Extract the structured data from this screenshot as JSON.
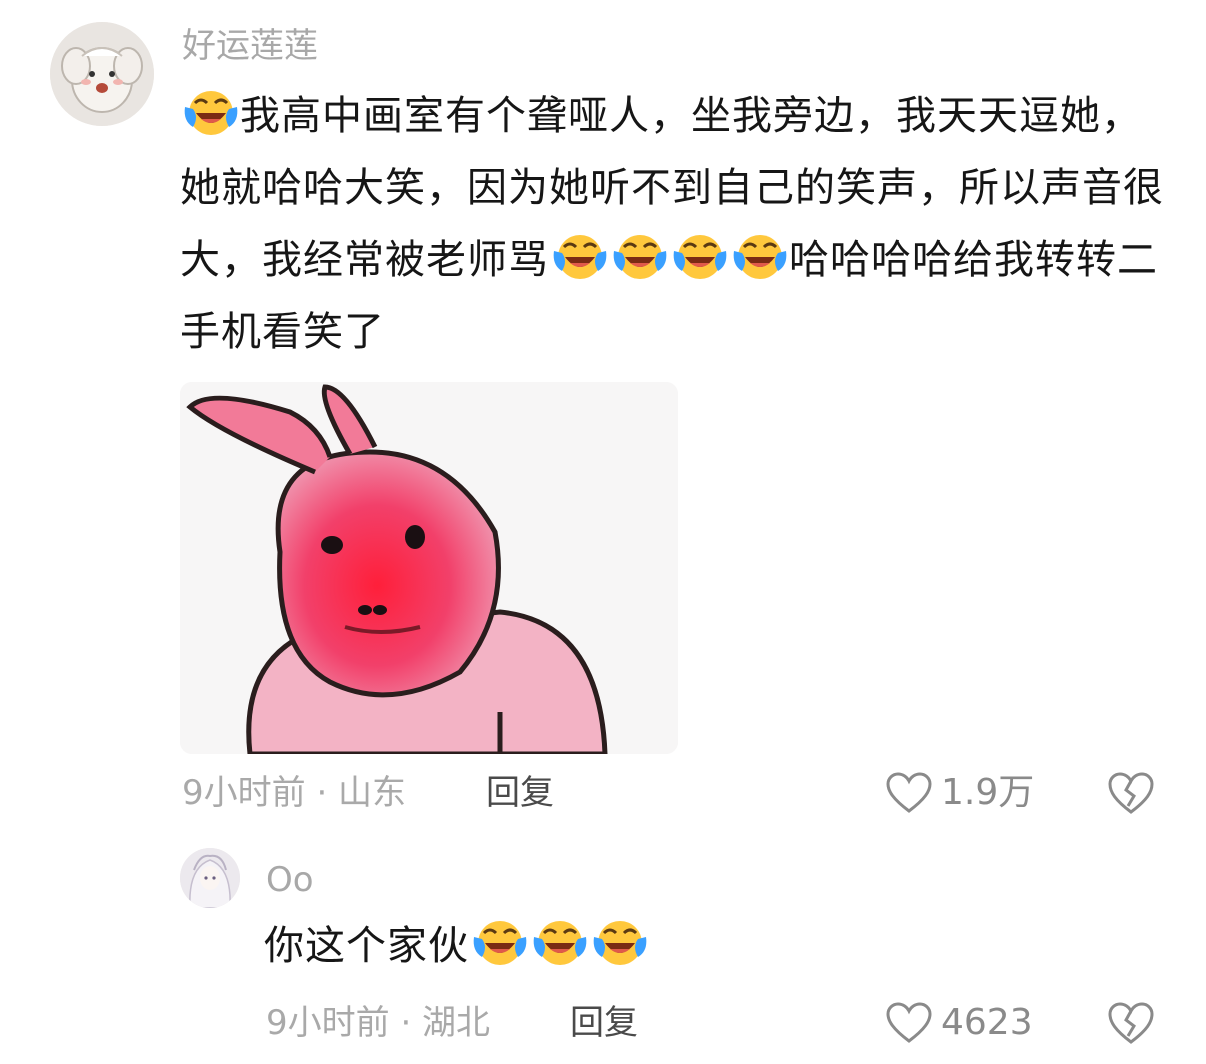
{
  "comments": [
    {
      "username": "好运莲莲",
      "text_segments": [
        "我高中画室有个聋哑人，坐我旁边，我天天逗她，她就哈哈大笑，因为她听不到自己的笑声，所以声音很大，我经常被老师骂",
        "哈哈哈哈给我转转二手机看笑了"
      ],
      "leading_emoji": "laughing-crying-emoji",
      "middle_emoji_count": 4,
      "time_location": "9小时前 · 山东",
      "reply_label": "回复",
      "like_count": "1.9万"
    },
    {
      "username": "Oo",
      "text": "你这个家伙",
      "trailing_emoji_count": 3,
      "time_location": "9小时前 · 湖北",
      "reply_label": "回复",
      "like_count": "4623"
    }
  ],
  "colors": {
    "username": "#a8a8a8",
    "meta": "#a9a9a9",
    "text": "#161616",
    "meme_red": "#f0305a",
    "emoji_yellow": "#ffc83d",
    "emoji_tear": "#3aa0ff"
  }
}
